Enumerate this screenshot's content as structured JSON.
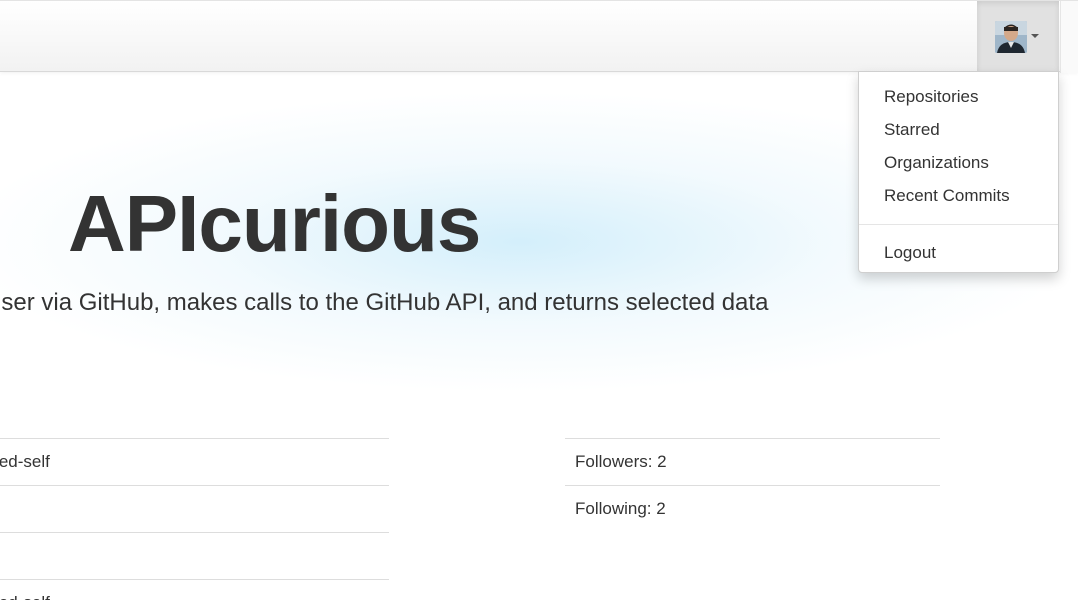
{
  "navbar": {
    "user_menu": {
      "avatar_icon": "user-avatar",
      "caret_icon": "caret-down-icon",
      "items": [
        {
          "label": "Repositories"
        },
        {
          "label": "Starred"
        },
        {
          "label": "Organizations"
        },
        {
          "label": "Recent Commits"
        }
      ],
      "logout_label": "Logout"
    }
  },
  "hero": {
    "title": "APIcurious",
    "subtitle": "es a user via GitHub, makes calls to the GitHub API, and returns selected data"
  },
  "left_table": {
    "rows": [
      {
        "text": "quantified-self"
      },
      {
        "text": ""
      },
      {
        "text": ""
      },
      {
        "text": "quantified-self"
      }
    ]
  },
  "right_table": {
    "rows": [
      {
        "text": "Followers: 2"
      },
      {
        "text": "Following: 2"
      }
    ]
  },
  "colors": {
    "text": "#333333",
    "border": "#dddddd",
    "hero_glow": "#ccecfa",
    "active_toggle": "#e1e1e1"
  }
}
